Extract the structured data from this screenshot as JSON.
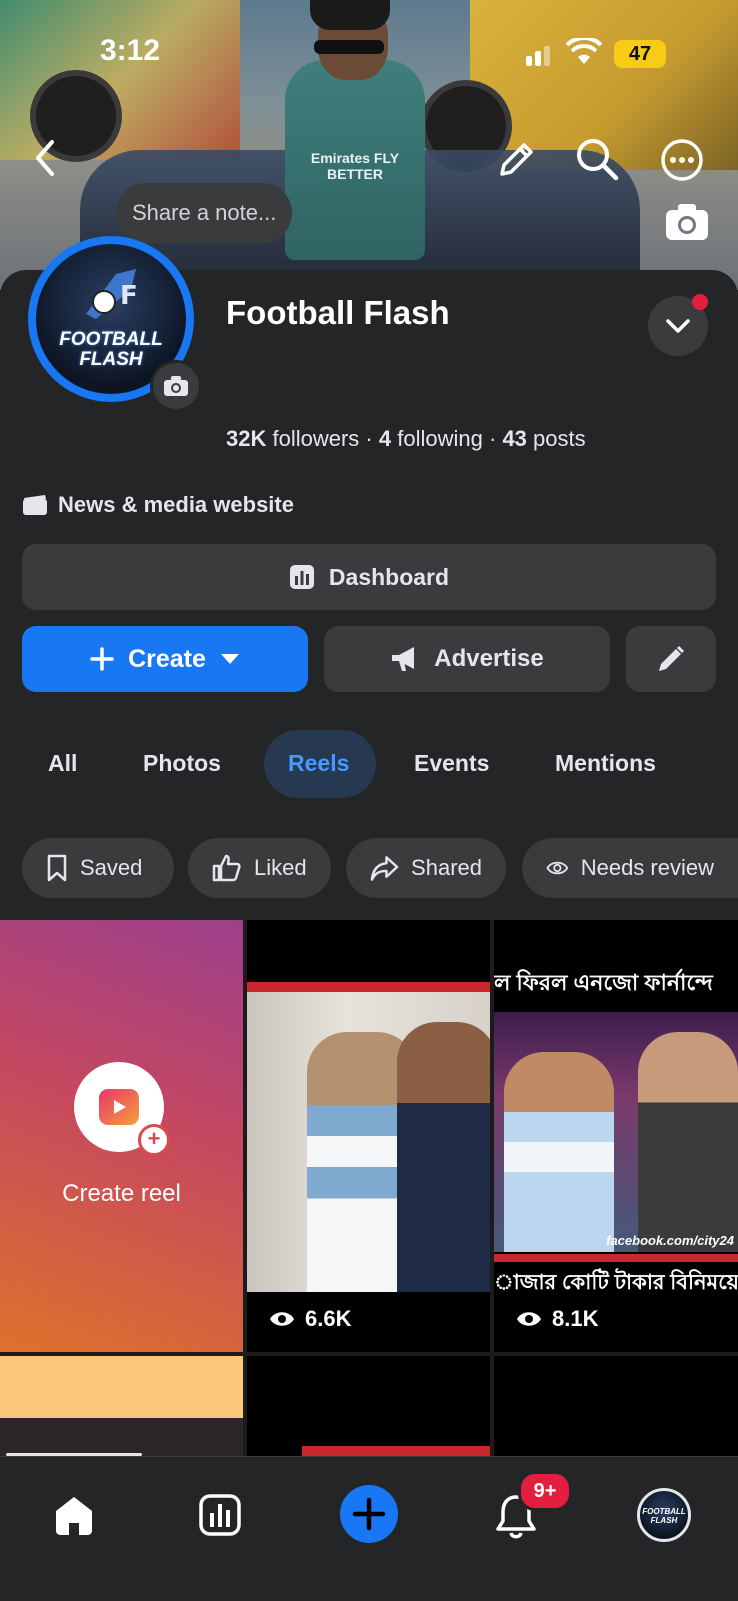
{
  "status_bar": {
    "time": "3:12",
    "battery": "47"
  },
  "note": {
    "placeholder": "Share a note..."
  },
  "profile": {
    "name": "Football Flash",
    "avatar_text": "FOOTBALL FLASH",
    "followers_count": "32K",
    "followers_label": "followers",
    "following_count": "4",
    "following_label": "following",
    "posts_count": "43",
    "posts_label": "posts",
    "category": "News & media website"
  },
  "actions": {
    "dashboard": "Dashboard",
    "create": "Create",
    "advertise": "Advertise"
  },
  "tabs": [
    "All",
    "Photos",
    "Reels",
    "Events",
    "Mentions"
  ],
  "active_tab": "Reels",
  "filters": [
    "Saved",
    "Liked",
    "Shared",
    "Needs review"
  ],
  "reels": {
    "create_label": "Create reel",
    "items": [
      {
        "views": "6.6K"
      },
      {
        "views": "8.1K",
        "headline_top": "ল ফিরল এনজো ফার্নান্দে",
        "headline_bottom": "াজার কোটি টাকার বিনিময়ে",
        "watermark": "facebook.com/city24"
      }
    ]
  },
  "cover": {
    "shirt_text": "Emirates FLY BETTER"
  },
  "nav": {
    "notifications_badge": "9+",
    "profile_avatar_text": "FOOTBALL FLASH"
  },
  "colors": {
    "accent": "#1877f2",
    "background": "#242526",
    "surface": "#3a3b3c",
    "active_tab_bg": "#263951",
    "active_tab_text": "#4599ff",
    "badge": "#e41e3f"
  }
}
